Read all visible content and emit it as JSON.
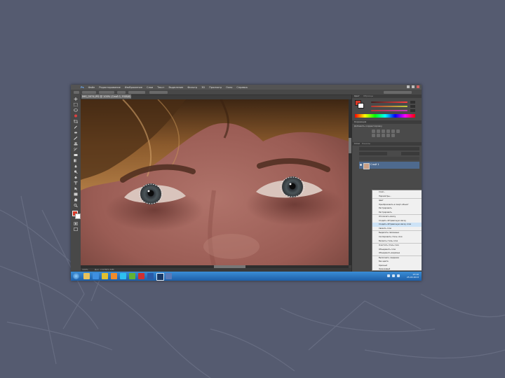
{
  "app": {
    "menu": [
      "Ps",
      "Файл",
      "Редактирование",
      "Изображение",
      "Слои",
      "Текст",
      "Выделение",
      "Фильтр",
      "3D",
      "Просмотр",
      "Окно",
      "Справка"
    ],
    "document_tab": "IMG_0074.JPG @ 100% (Слой 1, RGB/8)",
    "zoom": "100%",
    "doc_info": "Док: 2,67M/5,34M"
  },
  "panels": {
    "color_tab": "Цвет",
    "swatches_tab": "Образцы",
    "color_sliders": [
      {
        "label": "R",
        "value": "180",
        "color": "#e04848"
      },
      {
        "label": "G",
        "value": "64",
        "color": "#53b553"
      },
      {
        "label": "B",
        "value": "64",
        "color": "#4a6fd6"
      }
    ],
    "adjustments_tab": "Коррекция",
    "adjustments_title": "Добавить корректировку",
    "layers_tab": "Слои",
    "channels_tab": "Каналы",
    "layer_name": "Слой 1",
    "essentials": "Основная рабочая среда"
  },
  "context_menu": {
    "items": [
      {
        "label": "Слой...",
        "highlight": false,
        "sep": false
      },
      {
        "label": "Параметры...",
        "highlight": false,
        "sep": false
      },
      {
        "label": "Цвет",
        "highlight": false,
        "sep": true
      },
      {
        "label": "Преобразовать в смарт-объект",
        "highlight": false,
        "sep": false
      },
      {
        "label": "Растрировать",
        "highlight": false,
        "sep": false
      },
      {
        "label": "Растрировать",
        "highlight": false,
        "sep": false
      },
      {
        "label": "Отключить маску",
        "highlight": false,
        "sep": true
      },
      {
        "label": "Создать обтравочную маску",
        "highlight": false,
        "sep": false
      },
      {
        "label": "Создать обтравочную маску слоя",
        "highlight": true,
        "sep": false
      },
      {
        "label": "Связать слои",
        "highlight": false,
        "sep": false
      },
      {
        "label": "Выделить связанные",
        "highlight": false,
        "sep": true
      },
      {
        "label": "Скопировать стиль слоя",
        "highlight": false,
        "sep": false
      },
      {
        "label": "Вклеить стиль слоя",
        "highlight": false,
        "sep": false
      },
      {
        "label": "Очистить стиль слоя",
        "highlight": false,
        "sep": true
      },
      {
        "label": "Объединить слои",
        "highlight": false,
        "sep": false
      },
      {
        "label": "Объединить видимые",
        "highlight": false,
        "sep": false
      },
      {
        "label": "Выполнить сведение",
        "highlight": false,
        "sep": true
      },
      {
        "label": "Без цвета",
        "highlight": false,
        "sep": false
      },
      {
        "label": "Красный",
        "highlight": false,
        "sep": false
      },
      {
        "label": "Оранжевый",
        "highlight": false,
        "sep": false
      }
    ]
  },
  "taskbar": {
    "time": "13:10",
    "date": "25.03.2013"
  },
  "colors": {
    "accent": "#4e6a8e",
    "taskbar": "#2a72c2"
  }
}
